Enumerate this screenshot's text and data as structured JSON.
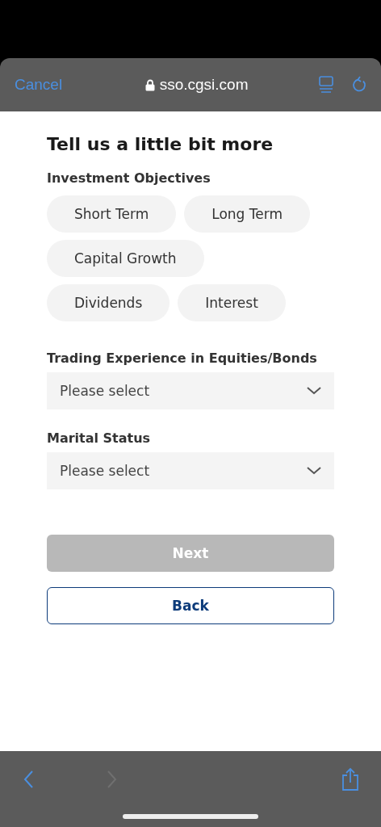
{
  "browser_bar": {
    "cancel": "Cancel",
    "url": "sso.cgsi.com"
  },
  "title": "Tell us a little bit more",
  "objectives": {
    "label": "Investment Objectives",
    "options": [
      {
        "label": "Short Term",
        "selected": false
      },
      {
        "label": "Long Term",
        "selected": false
      },
      {
        "label": "Capital Growth",
        "selected": false
      },
      {
        "label": "Dividends",
        "selected": false
      },
      {
        "label": "Interest",
        "selected": false
      }
    ]
  },
  "fields": [
    {
      "label": "Trading Experience in Equities/Bonds",
      "placeholder": "Please select"
    },
    {
      "label": "Marital Status",
      "placeholder": "Please select"
    }
  ],
  "next_button": {
    "label": "Next",
    "disabled": true
  },
  "back_button": {
    "label": "Back"
  },
  "toolbar": {
    "forward_disabled": true
  }
}
